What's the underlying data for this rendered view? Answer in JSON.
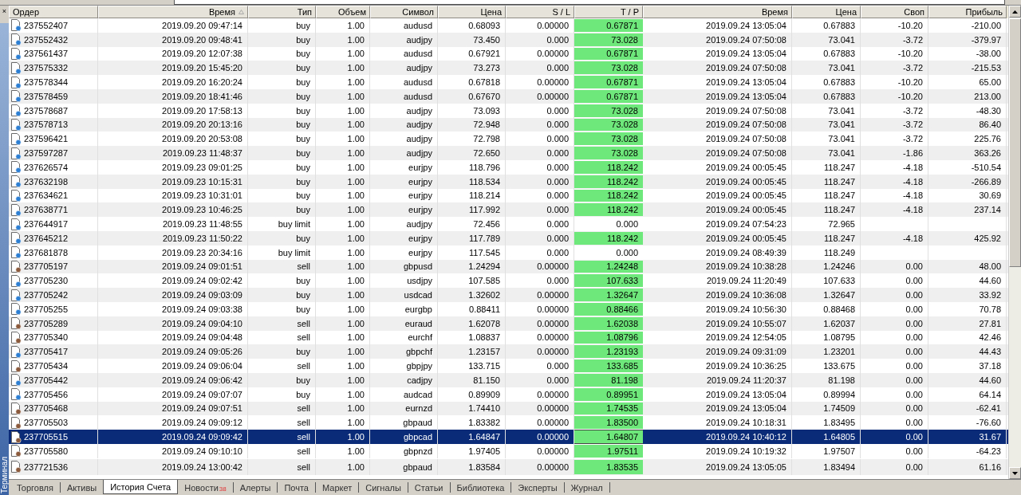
{
  "close_glyph": "×",
  "side_label": "Терминал",
  "columns": [
    {
      "label": "Ордер",
      "sorted": false
    },
    {
      "label": "Время",
      "sorted": true
    },
    {
      "label": "Тип",
      "sorted": false
    },
    {
      "label": "Объем",
      "sorted": false
    },
    {
      "label": "Символ",
      "sorted": false
    },
    {
      "label": "Цена",
      "sorted": false
    },
    {
      "label": "S / L",
      "sorted": false
    },
    {
      "label": "T / P",
      "sorted": false
    },
    {
      "label": "Время",
      "sorted": false
    },
    {
      "label": "Цена",
      "sorted": false
    },
    {
      "label": "Своп",
      "sorted": false
    },
    {
      "label": "Прибыль",
      "sorted": false
    }
  ],
  "rows": [
    {
      "kind": "buy",
      "selected": false,
      "tp_hit": true,
      "order": "237552407",
      "open_time": "2019.09.20 09:47:14",
      "type": "buy",
      "volume": "1.00",
      "symbol": "audusd",
      "price": "0.68093",
      "sl": "0.00000",
      "tp": "0.67871",
      "close_time": "2019.09.24 13:05:04",
      "close_price": "0.67883",
      "swap": "-10.20",
      "profit": "-210.00"
    },
    {
      "kind": "buy",
      "selected": false,
      "tp_hit": true,
      "order": "237552432",
      "open_time": "2019.09.20 09:48:41",
      "type": "buy",
      "volume": "1.00",
      "symbol": "audjpy",
      "price": "73.450",
      "sl": "0.000",
      "tp": "73.028",
      "close_time": "2019.09.24 07:50:08",
      "close_price": "73.041",
      "swap": "-3.72",
      "profit": "-379.97"
    },
    {
      "kind": "buy",
      "selected": false,
      "tp_hit": true,
      "order": "237561437",
      "open_time": "2019.09.20 12:07:38",
      "type": "buy",
      "volume": "1.00",
      "symbol": "audusd",
      "price": "0.67921",
      "sl": "0.00000",
      "tp": "0.67871",
      "close_time": "2019.09.24 13:05:04",
      "close_price": "0.67883",
      "swap": "-10.20",
      "profit": "-38.00"
    },
    {
      "kind": "buy",
      "selected": false,
      "tp_hit": true,
      "order": "237575332",
      "open_time": "2019.09.20 15:45:20",
      "type": "buy",
      "volume": "1.00",
      "symbol": "audjpy",
      "price": "73.273",
      "sl": "0.000",
      "tp": "73.028",
      "close_time": "2019.09.24 07:50:08",
      "close_price": "73.041",
      "swap": "-3.72",
      "profit": "-215.53"
    },
    {
      "kind": "buy",
      "selected": false,
      "tp_hit": true,
      "order": "237578344",
      "open_time": "2019.09.20 16:20:24",
      "type": "buy",
      "volume": "1.00",
      "symbol": "audusd",
      "price": "0.67818",
      "sl": "0.00000",
      "tp": "0.67871",
      "close_time": "2019.09.24 13:05:04",
      "close_price": "0.67883",
      "swap": "-10.20",
      "profit": "65.00"
    },
    {
      "kind": "buy",
      "selected": false,
      "tp_hit": true,
      "order": "237578459",
      "open_time": "2019.09.20 18:41:46",
      "type": "buy",
      "volume": "1.00",
      "symbol": "audusd",
      "price": "0.67670",
      "sl": "0.00000",
      "tp": "0.67871",
      "close_time": "2019.09.24 13:05:04",
      "close_price": "0.67883",
      "swap": "-10.20",
      "profit": "213.00"
    },
    {
      "kind": "buy",
      "selected": false,
      "tp_hit": true,
      "order": "237578687",
      "open_time": "2019.09.20 17:58:13",
      "type": "buy",
      "volume": "1.00",
      "symbol": "audjpy",
      "price": "73.093",
      "sl": "0.000",
      "tp": "73.028",
      "close_time": "2019.09.24 07:50:08",
      "close_price": "73.041",
      "swap": "-3.72",
      "profit": "-48.30"
    },
    {
      "kind": "buy",
      "selected": false,
      "tp_hit": true,
      "order": "237578713",
      "open_time": "2019.09.20 20:13:16",
      "type": "buy",
      "volume": "1.00",
      "symbol": "audjpy",
      "price": "72.948",
      "sl": "0.000",
      "tp": "73.028",
      "close_time": "2019.09.24 07:50:08",
      "close_price": "73.041",
      "swap": "-3.72",
      "profit": "86.40"
    },
    {
      "kind": "buy",
      "selected": false,
      "tp_hit": true,
      "order": "237596421",
      "open_time": "2019.09.20 20:53:08",
      "type": "buy",
      "volume": "1.00",
      "symbol": "audjpy",
      "price": "72.798",
      "sl": "0.000",
      "tp": "73.028",
      "close_time": "2019.09.24 07:50:08",
      "close_price": "73.041",
      "swap": "-3.72",
      "profit": "225.76"
    },
    {
      "kind": "buy",
      "selected": false,
      "tp_hit": true,
      "order": "237597287",
      "open_time": "2019.09.23 11:48:37",
      "type": "buy",
      "volume": "1.00",
      "symbol": "audjpy",
      "price": "72.650",
      "sl": "0.000",
      "tp": "73.028",
      "close_time": "2019.09.24 07:50:08",
      "close_price": "73.041",
      "swap": "-1.86",
      "profit": "363.26"
    },
    {
      "kind": "buy",
      "selected": false,
      "tp_hit": true,
      "order": "237626574",
      "open_time": "2019.09.23 09:01:25",
      "type": "buy",
      "volume": "1.00",
      "symbol": "eurjpy",
      "price": "118.796",
      "sl": "0.000",
      "tp": "118.242",
      "close_time": "2019.09.24 00:05:45",
      "close_price": "118.247",
      "swap": "-4.18",
      "profit": "-510.54"
    },
    {
      "kind": "buy",
      "selected": false,
      "tp_hit": true,
      "order": "237632198",
      "open_time": "2019.09.23 10:15:31",
      "type": "buy",
      "volume": "1.00",
      "symbol": "eurjpy",
      "price": "118.534",
      "sl": "0.000",
      "tp": "118.242",
      "close_time": "2019.09.24 00:05:45",
      "close_price": "118.247",
      "swap": "-4.18",
      "profit": "-266.89"
    },
    {
      "kind": "buy",
      "selected": false,
      "tp_hit": true,
      "order": "237634621",
      "open_time": "2019.09.23 10:31:01",
      "type": "buy",
      "volume": "1.00",
      "symbol": "eurjpy",
      "price": "118.214",
      "sl": "0.000",
      "tp": "118.242",
      "close_time": "2019.09.24 00:05:45",
      "close_price": "118.247",
      "swap": "-4.18",
      "profit": "30.69"
    },
    {
      "kind": "buy",
      "selected": false,
      "tp_hit": true,
      "order": "237638771",
      "open_time": "2019.09.23 10:46:25",
      "type": "buy",
      "volume": "1.00",
      "symbol": "eurjpy",
      "price": "117.992",
      "sl": "0.000",
      "tp": "118.242",
      "close_time": "2019.09.24 00:05:45",
      "close_price": "118.247",
      "swap": "-4.18",
      "profit": "237.14"
    },
    {
      "kind": "buy",
      "selected": false,
      "tp_hit": false,
      "order": "237644917",
      "open_time": "2019.09.23 11:48:55",
      "type": "buy limit",
      "volume": "1.00",
      "symbol": "audjpy",
      "price": "72.456",
      "sl": "0.000",
      "tp": "0.000",
      "close_time": "2019.09.24 07:54:23",
      "close_price": "72.965"
    },
    {
      "kind": "buy",
      "selected": false,
      "tp_hit": true,
      "order": "237645212",
      "open_time": "2019.09.23 11:50:22",
      "type": "buy",
      "volume": "1.00",
      "symbol": "eurjpy",
      "price": "117.789",
      "sl": "0.000",
      "tp": "118.242",
      "close_time": "2019.09.24 00:05:45",
      "close_price": "118.247",
      "swap": "-4.18",
      "profit": "425.92"
    },
    {
      "kind": "buy",
      "selected": false,
      "tp_hit": false,
      "order": "237681878",
      "open_time": "2019.09.23 20:34:16",
      "type": "buy limit",
      "volume": "1.00",
      "symbol": "eurjpy",
      "price": "117.545",
      "sl": "0.000",
      "tp": "0.000",
      "close_time": "2019.09.24 08:49:39",
      "close_price": "118.249"
    },
    {
      "kind": "sell",
      "selected": false,
      "tp_hit": true,
      "order": "237705197",
      "open_time": "2019.09.24 09:01:51",
      "type": "sell",
      "volume": "1.00",
      "symbol": "gbpusd",
      "price": "1.24294",
      "sl": "0.00000",
      "tp": "1.24248",
      "close_time": "2019.09.24 10:38:28",
      "close_price": "1.24246",
      "swap": "0.00",
      "profit": "48.00"
    },
    {
      "kind": "buy",
      "selected": false,
      "tp_hit": true,
      "order": "237705230",
      "open_time": "2019.09.24 09:02:42",
      "type": "buy",
      "volume": "1.00",
      "symbol": "usdjpy",
      "price": "107.585",
      "sl": "0.000",
      "tp": "107.633",
      "close_time": "2019.09.24 11:20:49",
      "close_price": "107.633",
      "swap": "0.00",
      "profit": "44.60"
    },
    {
      "kind": "buy",
      "selected": false,
      "tp_hit": true,
      "order": "237705242",
      "open_time": "2019.09.24 09:03:09",
      "type": "buy",
      "volume": "1.00",
      "symbol": "usdcad",
      "price": "1.32602",
      "sl": "0.00000",
      "tp": "1.32647",
      "close_time": "2019.09.24 10:36:08",
      "close_price": "1.32647",
      "swap": "0.00",
      "profit": "33.92"
    },
    {
      "kind": "buy",
      "selected": false,
      "tp_hit": true,
      "order": "237705255",
      "open_time": "2019.09.24 09:03:38",
      "type": "buy",
      "volume": "1.00",
      "symbol": "eurgbp",
      "price": "0.88411",
      "sl": "0.00000",
      "tp": "0.88466",
      "close_time": "2019.09.24 10:56:30",
      "close_price": "0.88468",
      "swap": "0.00",
      "profit": "70.78"
    },
    {
      "kind": "sell",
      "selected": false,
      "tp_hit": true,
      "order": "237705289",
      "open_time": "2019.09.24 09:04:10",
      "type": "sell",
      "volume": "1.00",
      "symbol": "euraud",
      "price": "1.62078",
      "sl": "0.00000",
      "tp": "1.62038",
      "close_time": "2019.09.24 10:55:07",
      "close_price": "1.62037",
      "swap": "0.00",
      "profit": "27.81"
    },
    {
      "kind": "sell",
      "selected": false,
      "tp_hit": true,
      "order": "237705340",
      "open_time": "2019.09.24 09:04:48",
      "type": "sell",
      "volume": "1.00",
      "symbol": "eurchf",
      "price": "1.08837",
      "sl": "0.00000",
      "tp": "1.08796",
      "close_time": "2019.09.24 12:54:05",
      "close_price": "1.08795",
      "swap": "0.00",
      "profit": "42.46"
    },
    {
      "kind": "buy",
      "selected": false,
      "tp_hit": true,
      "order": "237705417",
      "open_time": "2019.09.24 09:05:26",
      "type": "buy",
      "volume": "1.00",
      "symbol": "gbpchf",
      "price": "1.23157",
      "sl": "0.00000",
      "tp": "1.23193",
      "close_time": "2019.09.24 09:31:09",
      "close_price": "1.23201",
      "swap": "0.00",
      "profit": "44.43"
    },
    {
      "kind": "sell",
      "selected": false,
      "tp_hit": true,
      "order": "237705434",
      "open_time": "2019.09.24 09:06:04",
      "type": "sell",
      "volume": "1.00",
      "symbol": "gbpjpy",
      "price": "133.715",
      "sl": "0.000",
      "tp": "133.685",
      "close_time": "2019.09.24 10:36:25",
      "close_price": "133.675",
      "swap": "0.00",
      "profit": "37.18"
    },
    {
      "kind": "buy",
      "selected": false,
      "tp_hit": true,
      "order": "237705442",
      "open_time": "2019.09.24 09:06:42",
      "type": "buy",
      "volume": "1.00",
      "symbol": "cadjpy",
      "price": "81.150",
      "sl": "0.000",
      "tp": "81.198",
      "close_time": "2019.09.24 11:20:37",
      "close_price": "81.198",
      "swap": "0.00",
      "profit": "44.60"
    },
    {
      "kind": "buy",
      "selected": false,
      "tp_hit": true,
      "order": "237705456",
      "open_time": "2019.09.24 09:07:07",
      "type": "buy",
      "volume": "1.00",
      "symbol": "audcad",
      "price": "0.89909",
      "sl": "0.00000",
      "tp": "0.89951",
      "close_time": "2019.09.24 13:05:04",
      "close_price": "0.89994",
      "swap": "0.00",
      "profit": "64.14"
    },
    {
      "kind": "sell",
      "selected": false,
      "tp_hit": true,
      "order": "237705468",
      "open_time": "2019.09.24 09:07:51",
      "type": "sell",
      "volume": "1.00",
      "symbol": "eurnzd",
      "price": "1.74410",
      "sl": "0.00000",
      "tp": "1.74535",
      "close_time": "2019.09.24 13:05:04",
      "close_price": "1.74509",
      "swap": "0.00",
      "profit": "-62.41"
    },
    {
      "kind": "sell",
      "selected": false,
      "tp_hit": true,
      "order": "237705503",
      "open_time": "2019.09.24 09:09:12",
      "type": "sell",
      "volume": "1.00",
      "symbol": "gbpaud",
      "price": "1.83382",
      "sl": "0.00000",
      "tp": "1.83500",
      "close_time": "2019.09.24 10:18:31",
      "close_price": "1.83495",
      "swap": "0.00",
      "profit": "-76.60"
    },
    {
      "kind": "sell",
      "selected": true,
      "tp_hit": true,
      "order": "237705515",
      "open_time": "2019.09.24 09:09:42",
      "type": "sell",
      "volume": "1.00",
      "symbol": "gbpcad",
      "price": "1.64847",
      "sl": "0.00000",
      "tp": "1.64807",
      "close_time": "2019.09.24 10:40:12",
      "close_price": "1.64805",
      "swap": "0.00",
      "profit": "31.67"
    },
    {
      "kind": "sell",
      "selected": false,
      "tp_hit": true,
      "order": "237705580",
      "open_time": "2019.09.24 09:10:10",
      "type": "sell",
      "volume": "1.00",
      "symbol": "gbpnzd",
      "price": "1.97405",
      "sl": "0.00000",
      "tp": "1.97511",
      "close_time": "2019.09.24 10:19:32",
      "close_price": "1.97507",
      "swap": "0.00",
      "profit": "-64.23"
    },
    {
      "kind": "sell",
      "selected": false,
      "tp_hit": true,
      "order": "237721536",
      "open_time": "2019.09.24 13:00:42",
      "type": "sell",
      "volume": "1.00",
      "symbol": "gbpaud",
      "price": "1.83584",
      "sl": "0.00000",
      "tp": "1.83535",
      "close_time": "2019.09.24 13:05:05",
      "close_price": "1.83494",
      "swap": "0.00",
      "profit": "61.16"
    }
  ],
  "tabs": [
    {
      "label": "Торговля",
      "selected": false
    },
    {
      "label": "Активы",
      "selected": false
    },
    {
      "label": "История Счета",
      "selected": true
    },
    {
      "label": "Новости",
      "badge": "38",
      "selected": false
    },
    {
      "label": "Алерты",
      "selected": false
    },
    {
      "label": "Почта",
      "selected": false
    },
    {
      "label": "Маркет",
      "selected": false
    },
    {
      "label": "Сигналы",
      "selected": false
    },
    {
      "label": "Статьи",
      "selected": false
    },
    {
      "label": "Библиотека",
      "selected": false
    },
    {
      "label": "Эксперты",
      "selected": false
    },
    {
      "label": "Журнал",
      "selected": false
    }
  ]
}
